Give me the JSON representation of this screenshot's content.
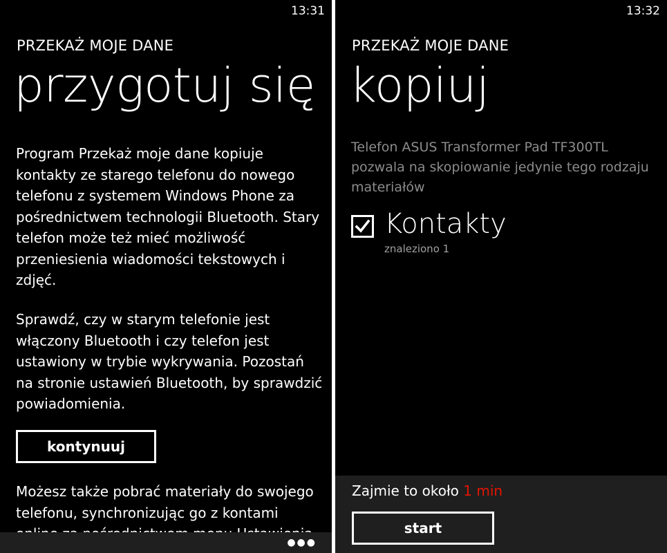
{
  "left": {
    "time": "13:31",
    "app_title": "PRZEKAŻ MOJE DANE",
    "page_title": "przygotuj się",
    "paragraph1": "Program Przekaż moje dane kopiuje kontakty ze starego telefonu do nowego telefonu z systemem Windows Phone za pośrednictwem technologii Bluetooth. Stary telefon może też mieć możliwość przeniesienia wiadomości tekstowych i zdjęć.",
    "paragraph2": "Sprawdź, czy w starym telefonie jest włączony Bluetooth i czy telefon jest ustawiony w trybie wykrywania. Pozostań na stronie ustawień Bluetooth, by sprawdzić powiadomienia.",
    "continue_label": "kontynuuj",
    "paragraph3": "Możesz także pobrać materiały do swojego telefonu, synchronizując go z kontami online za pośrednictwem menu Ustawienia",
    "more_icon": "ellipsis-icon"
  },
  "right": {
    "time": "13:32",
    "app_title": "PRZEKAŻ MOJE DANE",
    "page_title": "kopiuj",
    "description": "Telefon ASUS Transformer Pad TF300TL pozwala na skopiowanie jedynie tego rodzaju materiałów",
    "contacts_label": "Kontakty",
    "contacts_checked": true,
    "contacts_count": "znaleziono 1",
    "estimate_prefix": "Zajmie to około",
    "estimate_value": "1 min",
    "start_label": "start"
  },
  "colors": {
    "background": "#000000",
    "accent": "#e51400",
    "appbar": "#1f1f1f",
    "subtle_text": "#8c8c8c",
    "divider": "#ffffff"
  }
}
